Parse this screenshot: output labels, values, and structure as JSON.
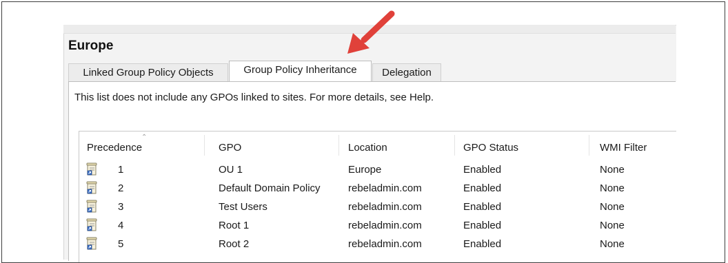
{
  "container": {
    "title": "Europe"
  },
  "tabs": [
    {
      "label": "Linked Group Policy Objects",
      "active": false
    },
    {
      "label": "Group Policy Inheritance",
      "active": true
    },
    {
      "label": "Delegation",
      "active": false
    }
  ],
  "info_text": "This list does not include any GPOs linked to sites. For more details, see Help.",
  "table": {
    "columns": [
      "Precedence",
      "GPO",
      "Location",
      "GPO Status",
      "WMI Filter"
    ],
    "sort_column": "Precedence",
    "rows": [
      {
        "precedence": "1",
        "gpo": "OU 1",
        "location": "Europe",
        "status": "Enabled",
        "wmi": "None"
      },
      {
        "precedence": "2",
        "gpo": "Default Domain Policy",
        "location": "rebeladmin.com",
        "status": "Enabled",
        "wmi": "None"
      },
      {
        "precedence": "3",
        "gpo": "Test Users",
        "location": "rebeladmin.com",
        "status": "Enabled",
        "wmi": "None"
      },
      {
        "precedence": "4",
        "gpo": "Root 1",
        "location": "rebeladmin.com",
        "status": "Enabled",
        "wmi": "None"
      },
      {
        "precedence": "5",
        "gpo": "Root 2",
        "location": "rebeladmin.com",
        "status": "Enabled",
        "wmi": "None"
      }
    ]
  },
  "icons": {
    "row_icon": "gpo-scroll-icon",
    "sort_indicator": "sort-caret-up-icon",
    "callout": "red-arrow-icon"
  },
  "colors": {
    "arrow": "#e0413a",
    "panel": "#f3f3f3",
    "border": "#3c3c3c"
  }
}
